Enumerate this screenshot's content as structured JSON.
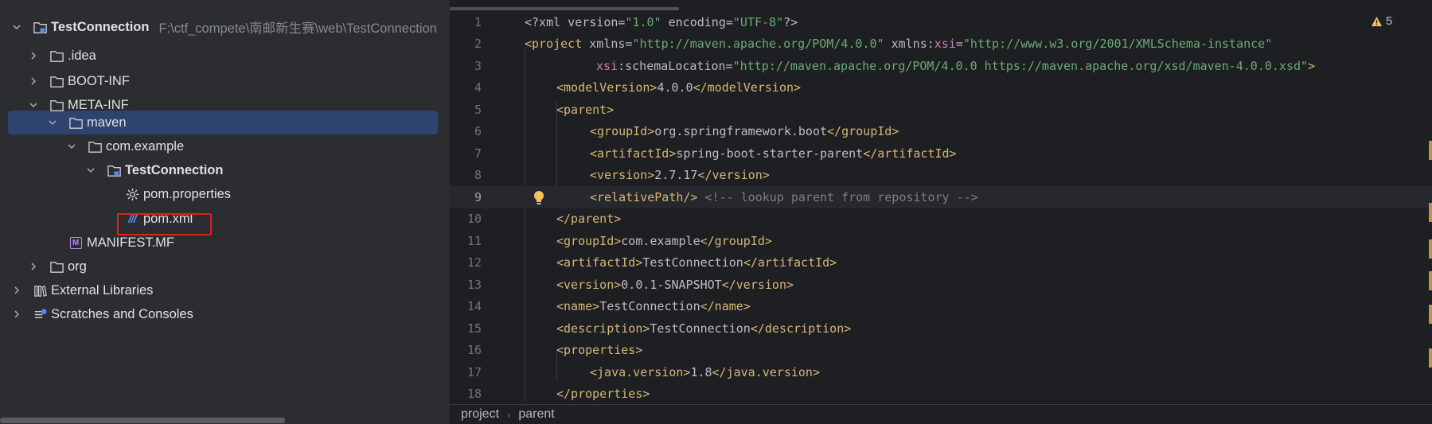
{
  "tree": {
    "root": {
      "label": "TestConnection",
      "path": "F:\\ctf_compete\\南邮新生赛\\web\\TestConnection"
    },
    "items": [
      {
        "label": ".idea"
      },
      {
        "label": "BOOT-INF"
      },
      {
        "label": "META-INF"
      },
      {
        "label": "maven"
      },
      {
        "label": "com.example"
      },
      {
        "label": "TestConnection"
      },
      {
        "label": "pom.properties"
      },
      {
        "label": "pom.xml"
      },
      {
        "label": "MANIFEST.MF"
      },
      {
        "label": "org"
      },
      {
        "label": "External Libraries"
      },
      {
        "label": "Scratches and Consoles"
      }
    ],
    "xml_icon_text": "///",
    "manifest_icon_text": "M"
  },
  "editor": {
    "warnings": "5",
    "lines": [
      "1",
      "2",
      "3",
      "4",
      "5",
      "6",
      "7",
      "8",
      "9",
      "10",
      "11",
      "12",
      "13",
      "14",
      "15",
      "16",
      "17",
      "18"
    ],
    "code": {
      "l1_a": "<?xml version=",
      "l1_b": "\"1.0\"",
      "l1_c": " encoding=",
      "l1_d": "\"UTF-8\"",
      "l1_e": "?>",
      "l2_tag": "<project",
      "l2_attr1": " xmlns=",
      "l2_val1": "\"http://maven.apache.org/POM/4.0.0\"",
      "l2_attr2": " xmlns:",
      "l2_ns": "xsi",
      "l2_eq": "=",
      "l2_val2": "\"http://www.w3.org/2001/XMLSchema-instance\"",
      "l3_ns": "xsi",
      "l3_attr": ":schemaLocation=",
      "l3_val": "\"http://maven.apache.org/POM/4.0.0 https://maven.apache.org/xsd/maven-4.0.0.xsd\"",
      "l3_end": ">",
      "l4_open": "<modelVersion>",
      "l4_text": "4.0.0",
      "l4_close": "</modelVersion>",
      "l5": "<parent>",
      "l6_open": "<groupId>",
      "l6_text": "org.springframework.boot",
      "l6_close": "</groupId>",
      "l7_open": "<artifactId>",
      "l7_text": "spring-boot-starter-parent",
      "l7_close": "</artifactId>",
      "l8_open": "<version>",
      "l8_text": "2.7.17",
      "l8_close": "</version>",
      "l9_tag": "<relativePath/>",
      "l9_comment": " <!-- lookup parent from repository -->",
      "l10": "</parent>",
      "l11_open": "<groupId>",
      "l11_text": "com.example",
      "l11_close": "</groupId>",
      "l12_open": "<artifactId>",
      "l12_text": "TestConnection",
      "l12_close": "</artifactId>",
      "l13_open": "<version>",
      "l13_text": "0.0.1-SNAPSHOT",
      "l13_close": "</version>",
      "l14_open": "<name>",
      "l14_text": "TestConnection",
      "l14_close": "</name>",
      "l15_open": "<description>",
      "l15_text": "TestConnection",
      "l15_close": "</description>",
      "l16": "<properties>",
      "l17_open": "<java.version>",
      "l17_text": "1.8",
      "l17_close": "</java.version>",
      "l18": "</properties>"
    },
    "breadcrumb": [
      "project",
      "parent"
    ]
  },
  "colors": {
    "selection": "#2e436e",
    "highlight_box": "#e11f1f",
    "tag": "#d5b778",
    "string": "#6aab73",
    "namespace": "#c77dbb",
    "comment": "#7a7e85"
  }
}
